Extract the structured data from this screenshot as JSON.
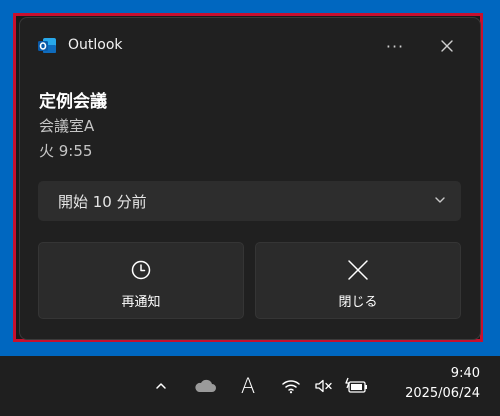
{
  "notification": {
    "app_name": "Outlook",
    "more_label": "···",
    "title": "定例会議",
    "location": "会議室A",
    "time": "火 9:55",
    "snooze_select": {
      "selected": "開始 10 分前"
    },
    "actions": {
      "snooze_label": "再通知",
      "dismiss_label": "閉じる"
    }
  },
  "taskbar": {
    "ime_label": "A",
    "clock_time": "9:40",
    "clock_date": "2025/06/24"
  },
  "colors": {
    "desktop": "#0067c0",
    "highlight_border": "#c8102e",
    "toast_bg": "#202020",
    "outlook_blue": "#0f6cbd"
  },
  "icons": [
    "outlook-icon",
    "more-icon",
    "close-icon",
    "chevron-down-icon",
    "clock-icon",
    "x-icon",
    "chevron-up-icon",
    "cloud-icon",
    "wifi-icon",
    "mute-speaker-icon",
    "battery-charging-icon"
  ]
}
